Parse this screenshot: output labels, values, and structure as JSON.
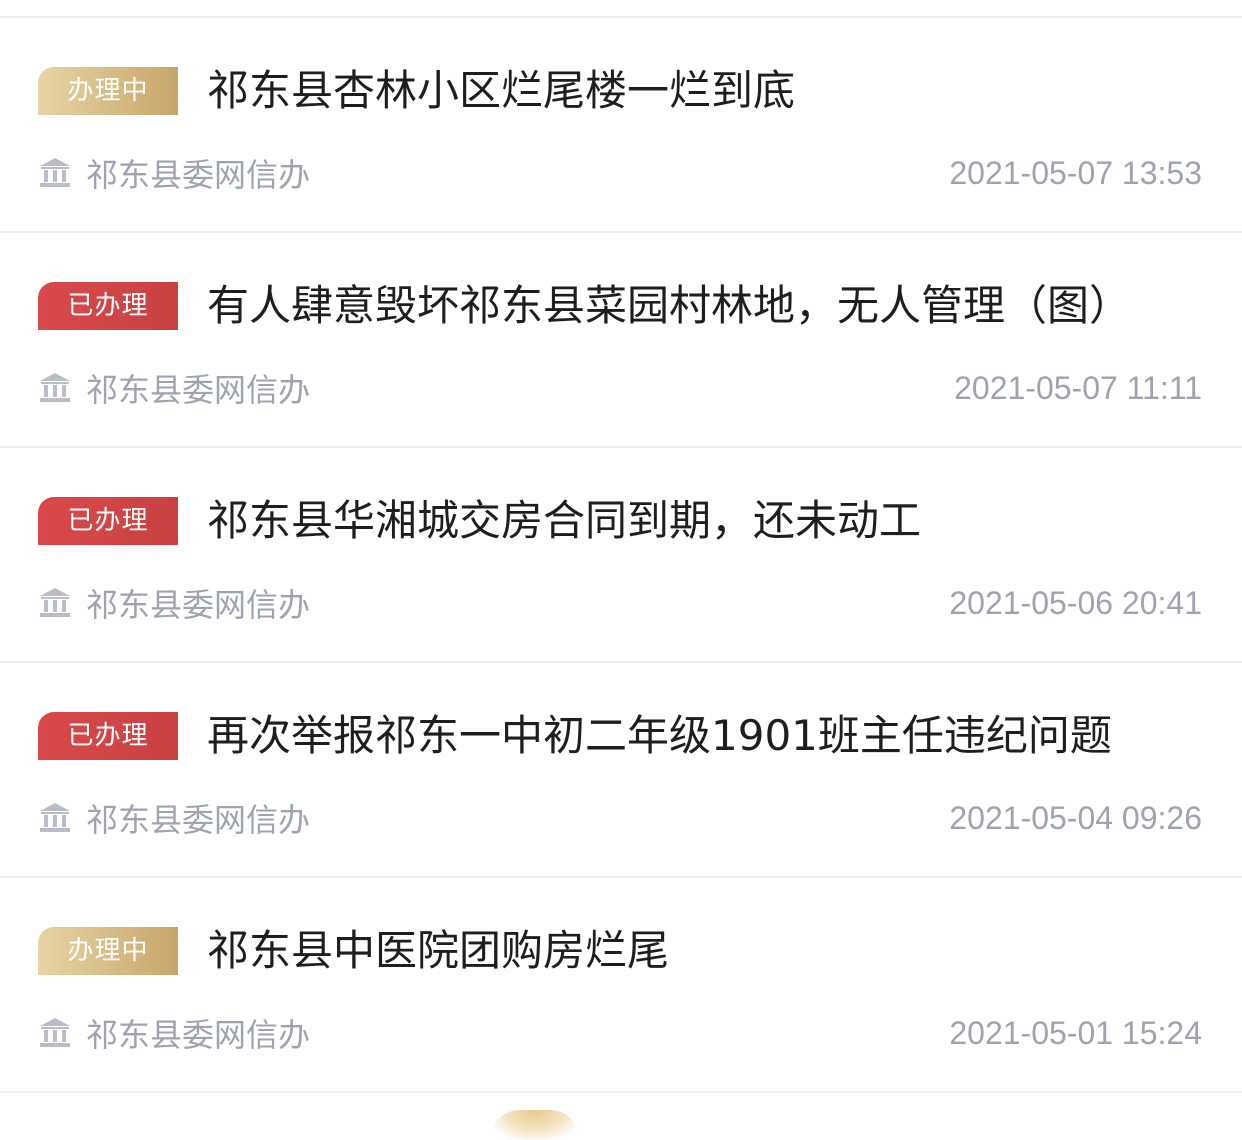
{
  "items": [
    {
      "status": "办理中",
      "status_type": "processing",
      "title": "祁东县杏林小区烂尾楼一烂到底",
      "source": "祁东县委网信办",
      "time": "2021-05-07 13:53",
      "source_icon": "government-building-icon"
    },
    {
      "status": "已办理",
      "status_type": "done",
      "title": "有人肆意毁坏祁东县菜园村林地，无人管理（图）",
      "source": "祁东县委网信办",
      "time": "2021-05-07 11:11",
      "source_icon": "government-building-icon"
    },
    {
      "status": "已办理",
      "status_type": "done",
      "title": "祁东县华湘城交房合同到期，还未动工",
      "source": "祁东县委网信办",
      "time": "2021-05-06 20:41",
      "source_icon": "government-building-icon"
    },
    {
      "status": "已办理",
      "status_type": "done",
      "title": "再次举报祁东一中初二年级1901班主任违纪问题",
      "source": "祁东县委网信办",
      "time": "2021-05-04 09:26",
      "source_icon": "government-building-icon"
    },
    {
      "status": "办理中",
      "status_type": "processing",
      "title": "祁东县中医院团购房烂尾",
      "source": "祁东县委网信办",
      "time": "2021-05-01 15:24",
      "source_icon": "government-building-icon"
    }
  ],
  "colors": {
    "processing": "#c6a66a",
    "done": "#d9494a",
    "meta_text": "#9ea3b0",
    "title_text": "#1e1e1e"
  }
}
